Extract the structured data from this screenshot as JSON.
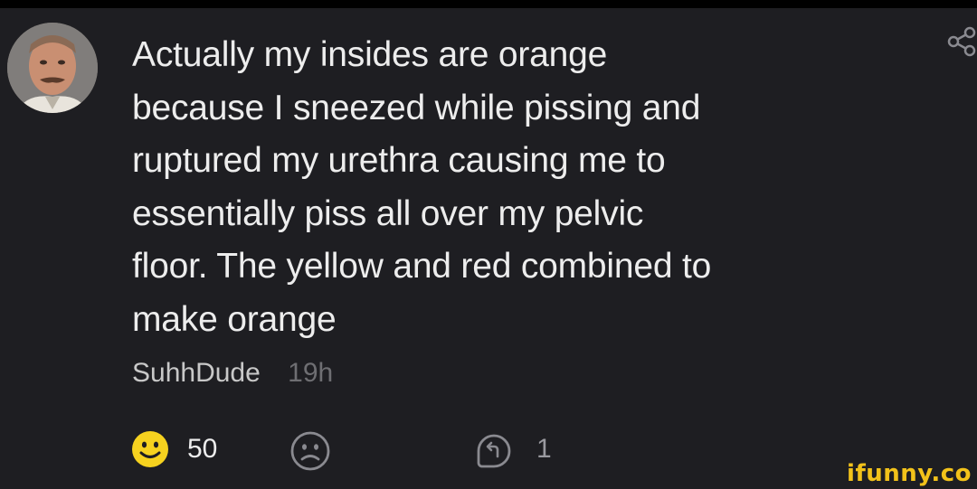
{
  "comment": {
    "text": "Actually my insides are orange\nbecause I sneezed while pissing and\nruptured my urethra causing me to\nessentially piss all over my pelvic\nfloor. The yellow and red combined to\nmake orange",
    "username": "SuhhDude",
    "timestamp": "19h"
  },
  "actions": {
    "like_count": "50",
    "reply_count": "1"
  },
  "icons": {
    "avatar": "avatar",
    "share": "share-icon",
    "like": "smile-icon",
    "dislike": "frown-icon",
    "reply": "reply-icon"
  },
  "colors": {
    "background": "#1e1e22",
    "text": "#ededed",
    "muted": "#6e6e72",
    "like_yellow": "#f6d21f",
    "watermark": "#f2c21a"
  },
  "watermark": "ifunny.co"
}
